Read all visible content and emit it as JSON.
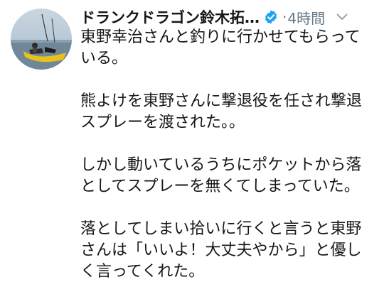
{
  "tweet": {
    "author": {
      "display_name": "ドランクドラゴン鈴木拓…",
      "verified_icon": "verified-badge-icon",
      "avatar_icon": "profile-photo-fishing-boat"
    },
    "separator": "·",
    "timestamp": "4時間",
    "menu_icon": "chevron-down-icon",
    "colors": {
      "text": "#14171a",
      "secondary": "#657786",
      "verified": "#1da1f2"
    },
    "body": [
      [
        "東野幸治さんと釣りに行かせてもらって",
        "いる。"
      ],
      [
        "熊よけを東野さんに撃退役を任され撃退",
        "スプレーを渡された。。"
      ],
      [
        "しかし動いているうちにポケットから落",
        "としてスプレーを無くてしまっていた。"
      ],
      [
        "落としてしまい拾いに行くと言うと東野",
        "さんは「いいよ！大丈夫やから」と優し",
        "く言ってくれた。"
      ]
    ]
  }
}
